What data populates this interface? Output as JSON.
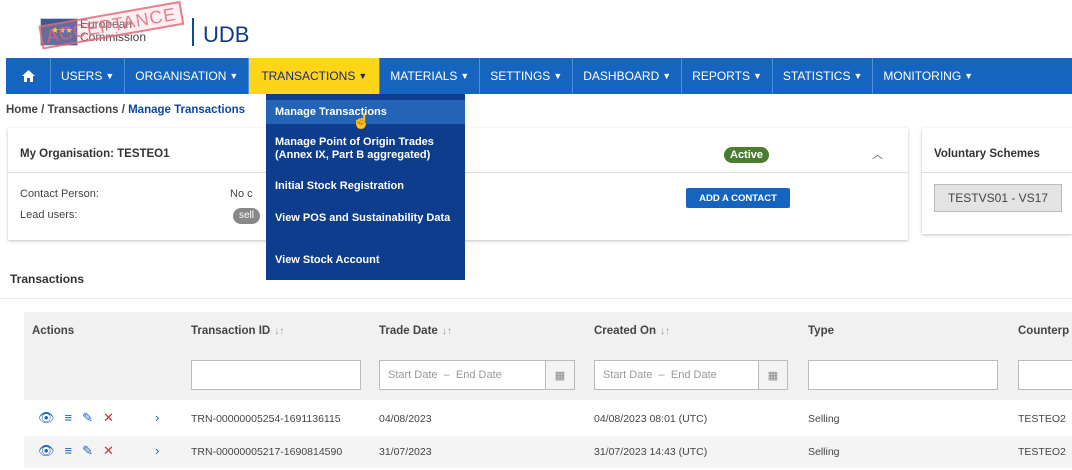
{
  "header": {
    "org_name_line1": "European",
    "org_name_line2": "Commission",
    "app_title": "UDB",
    "watermark": "ACCEPTANCE"
  },
  "nav": {
    "items": [
      {
        "label": "USERS",
        "active": false
      },
      {
        "label": "ORGANISATION",
        "active": false
      },
      {
        "label": "TRANSACTIONS",
        "active": true
      },
      {
        "label": "MATERIALS",
        "active": false
      },
      {
        "label": "SETTINGS",
        "active": false
      },
      {
        "label": "DASHBOARD",
        "active": false
      },
      {
        "label": "REPORTS",
        "active": false
      },
      {
        "label": "STATISTICS",
        "active": false
      },
      {
        "label": "MONITORING",
        "active": false
      }
    ]
  },
  "breadcrumb": {
    "home": "Home",
    "sep": " / ",
    "section": "Transactions",
    "current": "Manage Transactions"
  },
  "dropdown": {
    "items": [
      {
        "label": "Manage Transactions",
        "highlighted": true
      },
      {
        "label": "Manage Point of Origin Trades (Annex IX, Part B aggregated)",
        "highlighted": false
      },
      {
        "label": "Initial Stock Registration",
        "highlighted": false
      },
      {
        "label": "View POS and Sustainability Data",
        "highlighted": false
      },
      {
        "label": "View Stock Account",
        "highlighted": false
      }
    ]
  },
  "org_card": {
    "title": "My Organisation: TESTEO1",
    "status": "Active",
    "contact_label": "Contact Person:",
    "contact_value": "No c",
    "lead_label": "Lead users:",
    "lead_chip": "sell",
    "add_contact": "ADD A CONTACT"
  },
  "vs_card": {
    "title": "Voluntary Schemes",
    "chip": "TESTVS01 - VS17"
  },
  "transactions": {
    "title": "Transactions",
    "columns": [
      "Actions",
      "Transaction ID",
      "Trade Date",
      "Created On",
      "Type",
      "Counterp"
    ],
    "date_start_placeholder": "Start Date",
    "date_dash": "–",
    "date_end_placeholder": "End Date",
    "rows": [
      {
        "id": "TRN-00000005254-1691136115",
        "trade_date": "04/08/2023",
        "created_on": "04/08/2023 08:01 (UTC)",
        "type": "Selling",
        "counterparty": "TESTEO2"
      },
      {
        "id": "TRN-00000005217-1690814590",
        "trade_date": "31/07/2023",
        "created_on": "31/07/2023 14:43 (UTC)",
        "type": "Selling",
        "counterparty": "TESTEO2"
      }
    ]
  },
  "icons": {
    "home": "home-icon",
    "caret": "caret-down-icon",
    "view": "eye-icon",
    "list": "list-icon",
    "edit": "pencil-icon",
    "delete": "x-icon",
    "expand": "chevron-right-icon",
    "calendar": "calendar-icon",
    "sort": "sort-icon",
    "collapse": "chevron-up-icon",
    "cursor": "hand-cursor-icon"
  },
  "colors": {
    "nav_bg": "#1565c0",
    "nav_active_bg": "#ffd617",
    "dropdown_bg": "#0d3d8c",
    "active_badge": "#4a7d2f"
  }
}
